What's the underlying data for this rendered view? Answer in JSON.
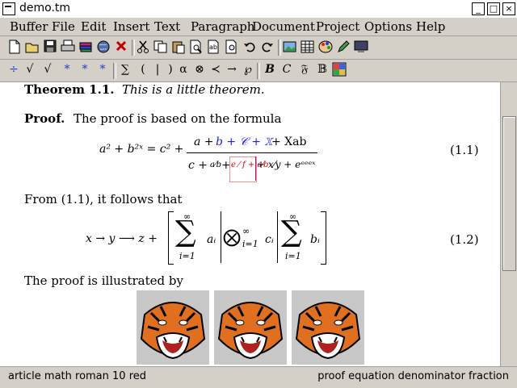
{
  "window": {
    "title": "demo.tm",
    "buttons": [
      "_",
      "□",
      "×"
    ]
  },
  "menubar": {
    "items": [
      "Buffer",
      "File",
      "Edit",
      "Insert",
      "Text",
      "Paragraph",
      "Document",
      "Project",
      "Options",
      "Help"
    ]
  },
  "toolbar1": {
    "icons": [
      "new-file-icon",
      "open-file-icon",
      "save-icon",
      "print-icon",
      "books-icon",
      "globe-icon",
      "close-x-icon",
      "cut-icon",
      "copy-icon",
      "paste-icon",
      "find-icon",
      "replace-icon",
      "spell-icon",
      "undo-icon",
      "redo-icon",
      "image-icon",
      "table-icon",
      "palette-icon",
      "pen-icon",
      "screen-icon"
    ]
  },
  "toolbar2": {
    "symbols": [
      "÷",
      "√",
      "√",
      "*",
      "*",
      "*",
      "∑",
      "(",
      "|",
      ")",
      "α",
      "⊗",
      "≺",
      "→",
      "℘",
      "B",
      "C",
      "𝔉",
      "𝔹",
      "⊞"
    ]
  },
  "document": {
    "theorem_label": "Theorem 1.1.",
    "theorem_text": "This is a little theorem.",
    "proof_label": "Proof.",
    "proof_text": "The proof is based on the formula",
    "eq1_lhs": "a² + b²ˣ = c² +",
    "eq1_num_a": "a +",
    "eq1_num_b": "b + 𝒞 + 𝕏",
    "eq1_num_c": "+ Xab",
    "eq1_den": "c + a/b + e/(f+a/b) + x/y + e^{e^{e^{e^x}}}",
    "eq1_den_c": "c +",
    "eq1_den_ab": "a⁄b",
    "eq1_den_plus": "+",
    "eq1_den_red": "e ⁄ f + a⁄b",
    "eq1_den_rest": "+ x⁄y + eᵉᵉᵉˣ",
    "eq1_number": "(1.1)",
    "follows_text": "From (1.1), it follows that",
    "eq2_lhs": "x → y ⟶ z +",
    "eq2_sum1": "∑",
    "eq2_sum1_top": "∞",
    "eq2_sum1_bot": "i=1",
    "eq2_a": "aᵢ",
    "eq2_otimes": "⨂",
    "eq2_otimes_top": "∞",
    "eq2_otimes_bot": "i=1",
    "eq2_c": "cᵢ",
    "eq2_sum2": "∑",
    "eq2_sum2_top": "∞",
    "eq2_sum2_bot": "i=1",
    "eq2_b": "bᵢ",
    "eq2_number": "(1.2)",
    "illustrated_text": "The proof is illustrated by"
  },
  "statusbar": {
    "left": "article math roman 10 red",
    "right": "proof equation denominator fraction"
  },
  "colors": {
    "math_blue": "#1a1aff",
    "math_red": "#e00000",
    "tiger_orange": "#e07020"
  }
}
